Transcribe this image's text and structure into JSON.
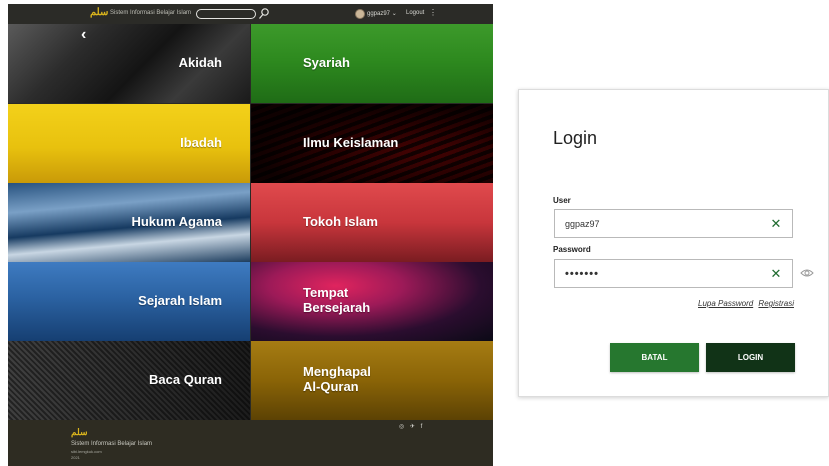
{
  "header": {
    "logo_text": "سلم",
    "app_title": "Sistem Informasi Belajar Islam",
    "search_value": "",
    "username": "ggpaz97 ⌄",
    "logout_label": "Logout",
    "menu_glyph": "⋮"
  },
  "grid": {
    "back_glyph": "‹",
    "tiles": [
      {
        "label": "Akidah"
      },
      {
        "label": "Syariah"
      },
      {
        "label": "Ibadah"
      },
      {
        "label": "Ilmu Keislaman"
      },
      {
        "label": "Hukum Agama"
      },
      {
        "label": "Tokoh Islam"
      },
      {
        "label": "Sejarah Islam"
      },
      {
        "label": "Tempat\nBersejarah"
      },
      {
        "label": "Baca Quran"
      },
      {
        "label": "Menghapal\nAl-Quran"
      }
    ]
  },
  "footer": {
    "logo_text": "سلم",
    "title": "Sistem Informasi Belajar Islam",
    "site": "sibi.lemgkuk.com",
    "year": "2021",
    "social": "◎ ✈ f"
  },
  "login": {
    "title": "Login",
    "user_label": "User",
    "user_value": "ggpaz97",
    "password_label": "Password",
    "password_value": "•••••••",
    "clear_glyph": "✕",
    "forgot_label": "Lupa Password",
    "register_label": "Registrasi",
    "cancel_label": "BATAL",
    "login_label": "LOGIN"
  },
  "colors": {
    "accent_green": "#26772f",
    "dark_green": "#113317",
    "clear_icon": "#1e6b2e",
    "logo_gold": "#d9b41d",
    "topbar": "#2b2b27"
  }
}
